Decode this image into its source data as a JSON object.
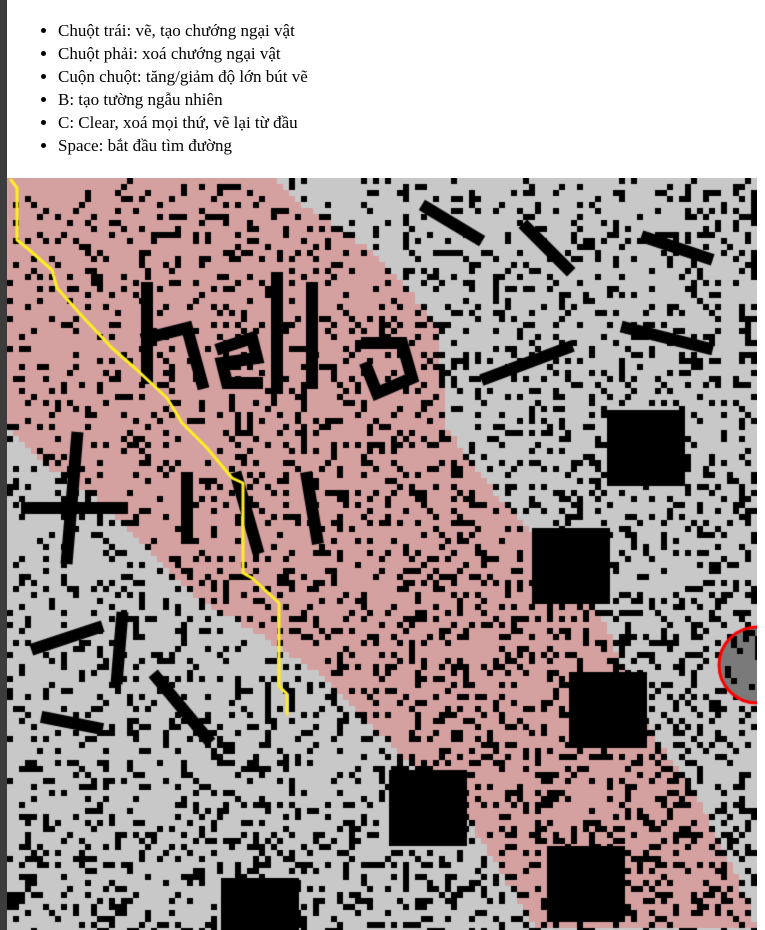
{
  "instructions": [
    "Chuột trái: vẽ, tạo chướng ngại vật",
    "Chuột phải: xoá chướng ngại vật",
    "Cuộn chuột: tăng/giảm độ lớn bút vẽ",
    "B: tạo tường ngẫu nhiên",
    "C: Clear, xoá mọi thứ, vẽ lại từ đầu",
    "Space: bắt đầu tìm đường"
  ],
  "colors": {
    "empty": "#c8c8c8",
    "wall": "#000000",
    "explored": "#d4a0a0",
    "path": "#ffee22",
    "target": "#ff0000",
    "target_fill": "#7a7a7a"
  }
}
